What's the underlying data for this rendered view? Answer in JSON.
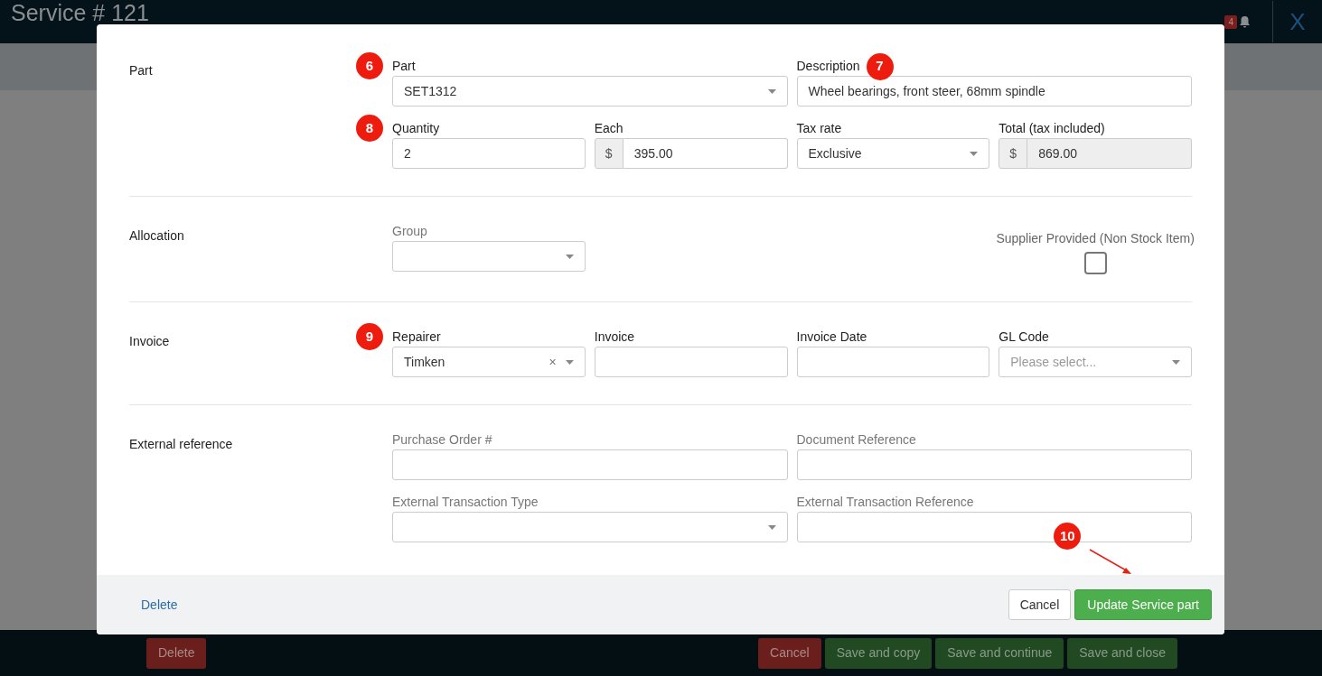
{
  "page": {
    "title": "Service # 121",
    "notification_count": "4",
    "close_label": "X"
  },
  "bottom_bar": {
    "left": [
      {
        "label": "Delete",
        "kind": "danger"
      }
    ],
    "right": [
      {
        "label": "Cancel",
        "kind": "danger"
      },
      {
        "label": "Save and copy",
        "kind": "success"
      },
      {
        "label": "Save and continue",
        "kind": "success"
      },
      {
        "label": "Save and close",
        "kind": "success"
      }
    ]
  },
  "modal": {
    "sections": [
      {
        "label": "Part",
        "lines": [
          {
            "fields": [
              {
                "kind": "select",
                "label": "Part",
                "value": "SET1312",
                "wide": true,
                "muted": false,
                "marker": "6"
              },
              {
                "kind": "input",
                "label": "Description",
                "value": "Wheel bearings, front steer, 68mm spindle",
                "wide": true,
                "muted": false,
                "marker": "7"
              }
            ]
          },
          {
            "fields": [
              {
                "kind": "input",
                "label": "Quantity",
                "value": "2",
                "wide": false,
                "muted": false,
                "marker": "8"
              },
              {
                "kind": "input",
                "label": "Each",
                "prefix": "$",
                "value": "395.00",
                "wide": false,
                "muted": false
              },
              {
                "kind": "select",
                "label": "Tax rate",
                "value": "Exclusive",
                "wide": false,
                "muted": false
              },
              {
                "kind": "input",
                "label": "Total (tax included)",
                "prefix": "$",
                "value": "869.00",
                "wide": false,
                "muted": false,
                "disabled": true
              }
            ]
          }
        ]
      },
      {
        "label": "Allocation",
        "lines": [
          {
            "fields": [
              {
                "kind": "select",
                "label": "Group",
                "wide": false,
                "muted": true
              },
              {
                "kind": "checkbox",
                "label": "Supplier Provided (Non Stock Item)",
                "checked": false,
                "muted": true
              }
            ]
          }
        ]
      },
      {
        "label": "Invoice",
        "lines": [
          {
            "fields": [
              {
                "kind": "select",
                "label": "Repairer",
                "value": "Timken",
                "clear": "×",
                "wide": false,
                "muted": false,
                "marker": "9"
              },
              {
                "kind": "input",
                "label": "Invoice",
                "wide": false,
                "muted": false
              },
              {
                "kind": "input",
                "label": "Invoice Date",
                "wide": false,
                "muted": false
              },
              {
                "kind": "select",
                "label": "GL Code",
                "placeholder": "Please select...",
                "wide": false,
                "muted": false
              }
            ]
          }
        ]
      },
      {
        "label": "External reference",
        "lines": [
          {
            "fields": [
              {
                "kind": "input",
                "label": "Purchase Order #",
                "wide": true,
                "muted": true
              },
              {
                "kind": "input",
                "label": "Document Reference",
                "wide": true,
                "muted": true
              }
            ]
          },
          {
            "fields": [
              {
                "kind": "select",
                "label": "External Transaction Type",
                "wide": true,
                "muted": true
              },
              {
                "kind": "input",
                "label": "External Transaction Reference",
                "wide": true,
                "muted": true
              }
            ]
          }
        ]
      }
    ],
    "footer": {
      "delete_label": "Delete",
      "cancel_label": "Cancel",
      "submit_label": "Update Service part",
      "submit_marker": "10"
    }
  }
}
